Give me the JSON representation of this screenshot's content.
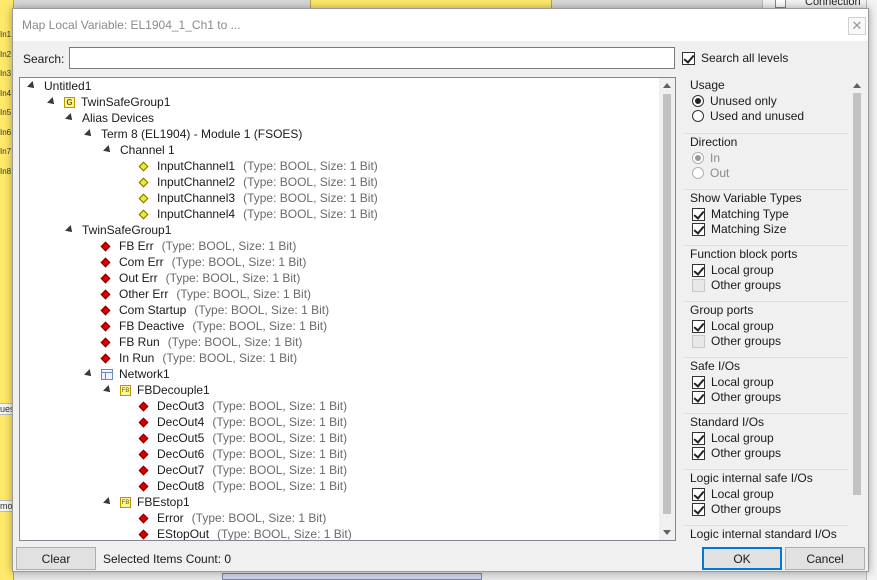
{
  "background": {
    "left_labels": [
      "In1",
      "In2",
      "In3",
      "In4",
      "In5",
      "In6",
      "In7",
      "In8"
    ],
    "left_fragment": "ues",
    "left_fragment2": "mov",
    "right_top_label": "Connection"
  },
  "dialog": {
    "title": "Map Local Variable: EL1904_1_Ch1 to ...",
    "close_glyph": "✕",
    "search_label": "Search:",
    "search_value": "",
    "search_all_label": "Search all levels"
  },
  "tree": {
    "root": "Untitled1",
    "group": "TwinSafeGroup1",
    "alias_devices": "Alias Devices",
    "term": "Term 8 (EL1904) - Module 1 (FSOES)",
    "channel": "Channel 1",
    "input_channels": [
      {
        "name": "InputChannel1",
        "type": "(Type: BOOL, Size: 1 Bit)"
      },
      {
        "name": "InputChannel2",
        "type": "(Type: BOOL, Size: 1 Bit)"
      },
      {
        "name": "InputChannel3",
        "type": "(Type: BOOL, Size: 1 Bit)"
      },
      {
        "name": "InputChannel4",
        "type": "(Type: BOOL, Size: 1 Bit)"
      }
    ],
    "group2": "TwinSafeGroup1",
    "group_vars": [
      {
        "name": "FB Err",
        "type": "(Type: BOOL, Size: 1 Bit)"
      },
      {
        "name": "Com Err",
        "type": "(Type: BOOL, Size: 1 Bit)"
      },
      {
        "name": "Out Err",
        "type": "(Type: BOOL, Size: 1 Bit)"
      },
      {
        "name": "Other Err",
        "type": "(Type: BOOL, Size: 1 Bit)"
      },
      {
        "name": "Com Startup",
        "type": "(Type: BOOL, Size: 1 Bit)"
      },
      {
        "name": "FB Deactive",
        "type": "(Type: BOOL, Size: 1 Bit)"
      },
      {
        "name": "FB Run",
        "type": "(Type: BOOL, Size: 1 Bit)"
      },
      {
        "name": "In Run",
        "type": "(Type: BOOL, Size: 1 Bit)"
      }
    ],
    "network": "Network1",
    "fb1": "FBDecouple1",
    "fb1_vars": [
      {
        "name": "DecOut3",
        "type": "(Type: BOOL, Size: 1 Bit)"
      },
      {
        "name": "DecOut4",
        "type": "(Type: BOOL, Size: 1 Bit)"
      },
      {
        "name": "DecOut5",
        "type": "(Type: BOOL, Size: 1 Bit)"
      },
      {
        "name": "DecOut6",
        "type": "(Type: BOOL, Size: 1 Bit)"
      },
      {
        "name": "DecOut7",
        "type": "(Type: BOOL, Size: 1 Bit)"
      },
      {
        "name": "DecOut8",
        "type": "(Type: BOOL, Size: 1 Bit)"
      }
    ],
    "fb2": "FBEstop1",
    "fb2_vars": [
      {
        "name": "Error",
        "type": "(Type: BOOL, Size: 1 Bit)"
      },
      {
        "name": "EStopOut",
        "type": "(Type: BOOL, Size: 1 Bit)"
      }
    ],
    "group_icon_letter": "G",
    "fb_icon_letter": "FB"
  },
  "panel": {
    "usage": {
      "title": "Usage",
      "options": [
        "Unused only",
        "Used and unused"
      ],
      "selected": 0
    },
    "direction": {
      "title": "Direction",
      "options": [
        "In",
        "Out"
      ],
      "selected": 0
    },
    "show_types": {
      "title": "Show Variable Types",
      "options": [
        "Matching Type",
        "Matching Size"
      ]
    },
    "fb_ports": {
      "title": "Function block ports",
      "options": [
        "Local group",
        "Other groups"
      ]
    },
    "group_ports": {
      "title": "Group ports",
      "options": [
        "Local group",
        "Other groups"
      ]
    },
    "safe_ios": {
      "title": "Safe I/Os",
      "options": [
        "Local group",
        "Other groups"
      ]
    },
    "standard_ios": {
      "title": "Standard I/Os",
      "options": [
        "Local group",
        "Other groups"
      ]
    },
    "logic_safe": {
      "title": "Logic internal safe I/Os",
      "options": [
        "Local group",
        "Other groups"
      ]
    },
    "logic_standard": {
      "title": "Logic internal standard I/Os"
    }
  },
  "footer": {
    "clear_label": "Clear",
    "count_text": "Selected Items Count: 0",
    "ok_label": "OK",
    "cancel_label": "Cancel"
  },
  "colors": {
    "accent": "#0078d7",
    "safe_red": "#d40000",
    "alias_yellow": "#f7e53a"
  }
}
